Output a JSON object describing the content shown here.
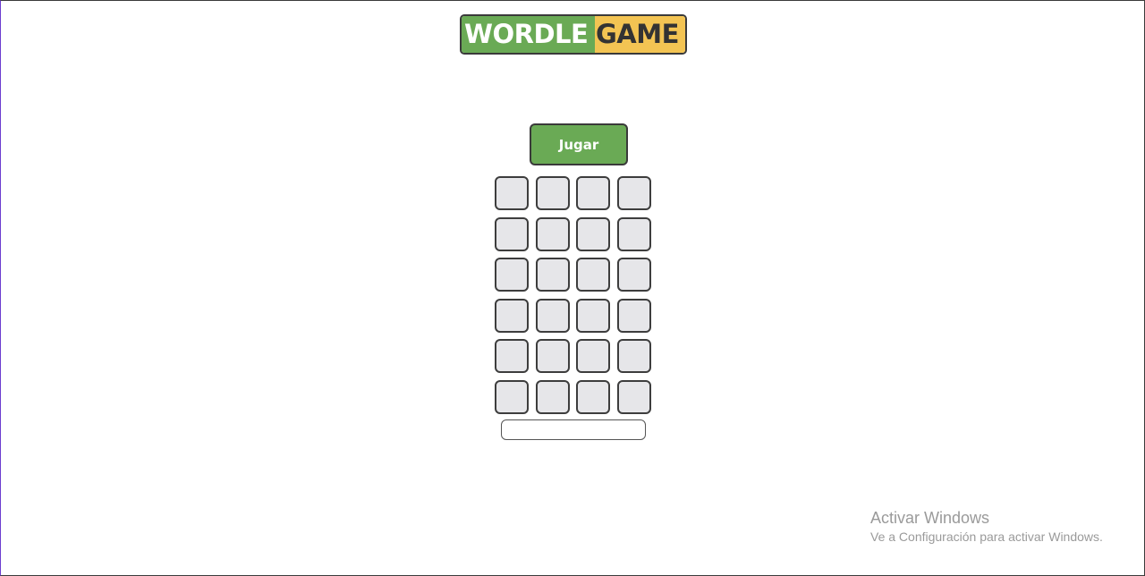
{
  "logo": {
    "part1": "WORDLE",
    "part2": "GAME"
  },
  "play_button": {
    "label": "Jugar"
  },
  "board": {
    "rows": 6,
    "columns": 4,
    "tiles": [
      [
        "",
        "",
        "",
        ""
      ],
      [
        "",
        "",
        "",
        ""
      ],
      [
        "",
        "",
        "",
        ""
      ],
      [
        "",
        "",
        "",
        ""
      ],
      [
        "",
        "",
        "",
        ""
      ],
      [
        "",
        "",
        "",
        ""
      ]
    ]
  },
  "guess_input": {
    "value": "",
    "placeholder": ""
  },
  "windows_activation": {
    "title": "Activar Windows",
    "subtitle": "Ve a Configuración para activar Windows."
  },
  "colors": {
    "green": "#6aaa55",
    "yellow": "#f3c453",
    "tile_background": "#e6e6e9",
    "border": "#3a3a3a"
  }
}
